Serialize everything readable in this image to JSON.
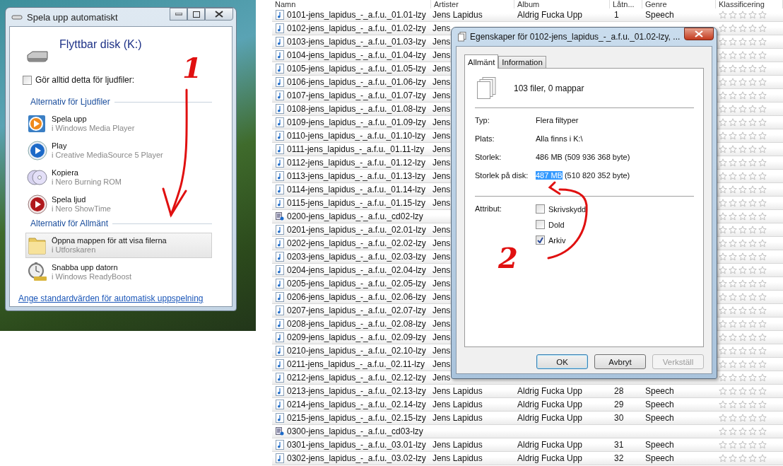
{
  "autoplay_dialog": {
    "title": "Spela upp automatiskt",
    "drive_label": "Flyttbar disk (K:)",
    "always_checkbox": {
      "label": "Gör alltid detta för ljudfiler:",
      "checked": false
    },
    "sections": [
      {
        "heading": "Alternativ för Ljudfiler",
        "options": [
          {
            "kind": "media-player",
            "title": "Spela upp",
            "subtitle": "i Windows Media Player",
            "selected": false
          },
          {
            "kind": "play",
            "title": "Play",
            "subtitle": "i Creative MediaSource 5 Player",
            "selected": false
          },
          {
            "kind": "copy",
            "title": "Kopiera",
            "subtitle": "i Nero Burning ROM",
            "selected": false
          },
          {
            "kind": "play-audio",
            "title": "Spela ljud",
            "subtitle": "i Nero ShowTime",
            "selected": false
          }
        ]
      },
      {
        "heading": "Alternativ för Allmänt",
        "options": [
          {
            "kind": "folder",
            "title": "Öppna mappen för att visa filerna",
            "subtitle": "i Utforskaren",
            "selected": true
          },
          {
            "kind": "speed-up",
            "title": "Snabba upp datorn",
            "subtitle": "i Windows ReadyBoost",
            "selected": false
          }
        ]
      }
    ],
    "link": "Ange standardvärden för automatisk uppspelning"
  },
  "file_list": {
    "columns": [
      "Namn",
      "Artister",
      "Album",
      "Låtn...",
      "Genre",
      "Klassificering"
    ],
    "rows": [
      {
        "kind": "audio",
        "name": "0101-jens_lapidus_-_a.f.u._01.01-lzy",
        "artist": "Jens Lapidus",
        "album": "Aldrig Fucka Upp",
        "track": "1",
        "genre": "Speech",
        "stars": 0
      },
      {
        "kind": "audio",
        "name": "0102-jens_lapidus_-_a.f.u._01.02-lzy",
        "artist": "Jens",
        "stars": 0
      },
      {
        "kind": "audio",
        "name": "0103-jens_lapidus_-_a.f.u._01.03-lzy",
        "artist": "Jens",
        "stars": 0
      },
      {
        "kind": "audio",
        "name": "0104-jens_lapidus_-_a.f.u._01.04-lzy",
        "artist": "Jens",
        "stars": 0
      },
      {
        "kind": "audio",
        "name": "0105-jens_lapidus_-_a.f.u._01.05-lzy",
        "artist": "Jens",
        "stars": 0
      },
      {
        "kind": "audio",
        "name": "0106-jens_lapidus_-_a.f.u._01.06-lzy",
        "artist": "Jens",
        "stars": 0
      },
      {
        "kind": "audio",
        "name": "0107-jens_lapidus_-_a.f.u._01.07-lzy",
        "artist": "Jens",
        "stars": 0
      },
      {
        "kind": "audio",
        "name": "0108-jens_lapidus_-_a.f.u._01.08-lzy",
        "artist": "Jens",
        "stars": 0
      },
      {
        "kind": "audio",
        "name": "0109-jens_lapidus_-_a.f.u._01.09-lzy",
        "artist": "Jens",
        "stars": 0
      },
      {
        "kind": "audio",
        "name": "0110-jens_lapidus_-_a.f.u._01.10-lzy",
        "artist": "Jens",
        "stars": 0
      },
      {
        "kind": "audio",
        "name": "0111-jens_lapidus_-_a.f.u._01.11-lzy",
        "artist": "Jens",
        "stars": 0
      },
      {
        "kind": "audio",
        "name": "0112-jens_lapidus_-_a.f.u._01.12-lzy",
        "artist": "Jens",
        "stars": 0
      },
      {
        "kind": "audio",
        "name": "0113-jens_lapidus_-_a.f.u._01.13-lzy",
        "artist": "Jens",
        "stars": 0
      },
      {
        "kind": "audio",
        "name": "0114-jens_lapidus_-_a.f.u._01.14-lzy",
        "artist": "Jens",
        "stars": 0
      },
      {
        "kind": "audio",
        "name": "0115-jens_lapidus_-_a.f.u._01.15-lzy",
        "artist": "Jens",
        "stars": 0
      },
      {
        "kind": "playlist",
        "name": "0200-jens_lapidus_-_a.f.u._cd02-lzy",
        "stars": 0
      },
      {
        "kind": "audio",
        "name": "0201-jens_lapidus_-_a.f.u._02.01-lzy",
        "artist": "Jens",
        "stars": 0
      },
      {
        "kind": "audio",
        "name": "0202-jens_lapidus_-_a.f.u._02.02-lzy",
        "artist": "Jens",
        "stars": 0
      },
      {
        "kind": "audio",
        "name": "0203-jens_lapidus_-_a.f.u._02.03-lzy",
        "artist": "Jens",
        "stars": 0
      },
      {
        "kind": "audio",
        "name": "0204-jens_lapidus_-_a.f.u._02.04-lzy",
        "artist": "Jens",
        "stars": 0
      },
      {
        "kind": "audio",
        "name": "0205-jens_lapidus_-_a.f.u._02.05-lzy",
        "artist": "Jens",
        "stars": 0
      },
      {
        "kind": "audio",
        "name": "0206-jens_lapidus_-_a.f.u._02.06-lzy",
        "artist": "Jens",
        "stars": 0
      },
      {
        "kind": "audio",
        "name": "0207-jens_lapidus_-_a.f.u._02.07-lzy",
        "artist": "Jens",
        "stars": 0
      },
      {
        "kind": "audio",
        "name": "0208-jens_lapidus_-_a.f.u._02.08-lzy",
        "artist": "Jens",
        "stars": 0
      },
      {
        "kind": "audio",
        "name": "0209-jens_lapidus_-_a.f.u._02.09-lzy",
        "artist": "Jens",
        "stars": 0
      },
      {
        "kind": "audio",
        "name": "0210-jens_lapidus_-_a.f.u._02.10-lzy",
        "artist": "Jens",
        "stars": 0
      },
      {
        "kind": "audio",
        "name": "0211-jens_lapidus_-_a.f.u._02.11-lzy",
        "artist": "Jens",
        "stars": 0
      },
      {
        "kind": "audio",
        "name": "0212-jens_lapidus_-_a.f.u._02.12-lzy",
        "artist": "Jens",
        "stars": 0
      },
      {
        "kind": "audio",
        "name": "0213-jens_lapidus_-_a.f.u._02.13-lzy",
        "artist": "Jens Lapidus",
        "album": "Aldrig Fucka Upp",
        "track": "28",
        "genre": "Speech",
        "stars": 0
      },
      {
        "kind": "audio",
        "name": "0214-jens_lapidus_-_a.f.u._02.14-lzy",
        "artist": "Jens Lapidus",
        "album": "Aldrig Fucka Upp",
        "track": "29",
        "genre": "Speech",
        "stars": 0
      },
      {
        "kind": "audio",
        "name": "0215-jens_lapidus_-_a.f.u._02.15-lzy",
        "artist": "Jens Lapidus",
        "album": "Aldrig Fucka Upp",
        "track": "30",
        "genre": "Speech",
        "stars": 0
      },
      {
        "kind": "playlist",
        "name": "0300-jens_lapidus_-_a.f.u._cd03-lzy",
        "stars": 0
      },
      {
        "kind": "audio",
        "name": "0301-jens_lapidus_-_a.f.u._03.01-lzy",
        "artist": "Jens Lapidus",
        "album": "Aldrig Fucka Upp",
        "track": "31",
        "genre": "Speech",
        "stars": 0
      },
      {
        "kind": "audio",
        "name": "0302-jens_lapidus_-_a.f.u._03.02-lzy",
        "artist": "Jens Lapidus",
        "album": "Aldrig Fucka Upp",
        "track": "32",
        "genre": "Speech",
        "stars": 0
      }
    ]
  },
  "properties_dialog": {
    "title": "Egenskaper för 0102-jens_lapidus_-_a.f.u._01.02-lzy, ...",
    "tabs": [
      {
        "label": "Allmänt",
        "selected": true
      },
      {
        "label": "Information",
        "selected": false
      }
    ],
    "summary": "103 filer, 0 mappar",
    "properties": [
      {
        "label": "Typ:",
        "parts": [
          {
            "text": "Flera filtyper",
            "selected": false
          }
        ]
      },
      {
        "label": "Plats:",
        "parts": [
          {
            "text": "Alla finns i K:\\",
            "selected": false
          }
        ]
      },
      {
        "label": "Storlek:",
        "parts": [
          {
            "text": "486 MB (509 936 368 byte)",
            "selected": false
          }
        ]
      },
      {
        "label": "Storlek på disk:",
        "parts": [
          {
            "text": "487 MB",
            "selected": true
          },
          {
            "text": "(510 820 352 byte)",
            "selected": false
          }
        ]
      }
    ],
    "attributes_label": "Attribut:",
    "attributes": [
      {
        "label": "Skrivskydd",
        "checked": false
      },
      {
        "label": "Dold",
        "checked": false
      },
      {
        "label": "Arkiv",
        "checked": true
      }
    ],
    "buttons": [
      {
        "label": "OK",
        "default": true,
        "disabled": false
      },
      {
        "label": "Avbryt",
        "default": false,
        "disabled": false
      },
      {
        "label": "Verkställ",
        "default": false,
        "disabled": true
      }
    ]
  },
  "annotations": [
    {
      "text": "1"
    },
    {
      "text": "2"
    }
  ]
}
